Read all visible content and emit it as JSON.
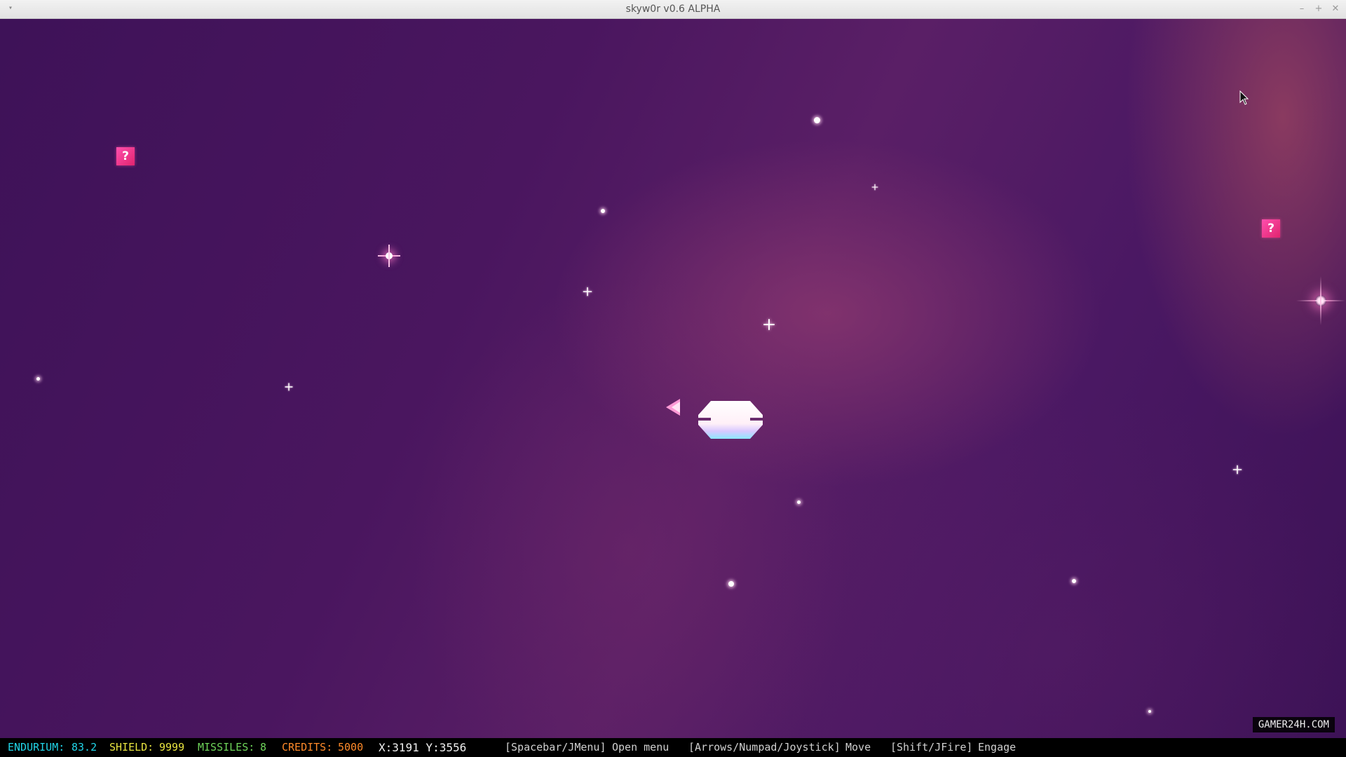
{
  "window": {
    "title": "skyw0r v0.6 ALPHA",
    "menu_glyph": "▾",
    "minimize_glyph": "–",
    "maximize_glyph": "+",
    "close_glyph": "✕"
  },
  "world": {
    "mystery_box_glyph": "?",
    "watermark": "GAMER24H.COM"
  },
  "hud": {
    "endurium": {
      "label": "ENDURIUM:",
      "value": "83.2"
    },
    "shield": {
      "label": "SHIELD:",
      "value": "9999"
    },
    "missiles": {
      "label": "MISSILES:",
      "value": "8"
    },
    "credits": {
      "label": "CREDITS:",
      "value": "5000"
    },
    "coords": "X:3191 Y:3556",
    "hints": [
      {
        "key": "[Spacebar/JMenu]",
        "action": "Open menu"
      },
      {
        "key": "[Arrows/Numpad/Joystick]",
        "action": "Move"
      },
      {
        "key": "[Shift/JFire]",
        "action": "Engage"
      }
    ]
  },
  "colors": {
    "endurium": "#21d4e8",
    "shield": "#e8e440",
    "missiles": "#6ed45a",
    "credits": "#ff8a2a",
    "mystery_box": "#ff4fae"
  }
}
